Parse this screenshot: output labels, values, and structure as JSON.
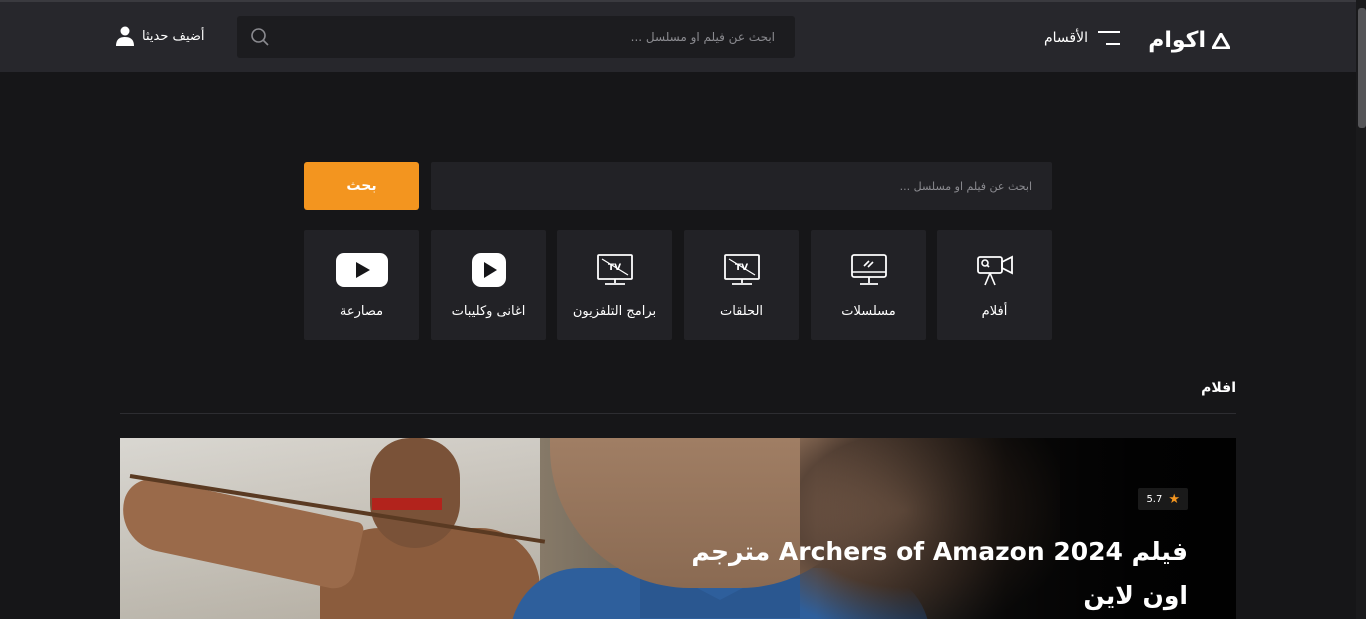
{
  "header": {
    "logo_text": "اكوام",
    "menu_label": "الأقسام",
    "search_placeholder": "ابحث عن فيلم او مسلسل ...",
    "recent_label": "أضيف حديثا"
  },
  "main_search": {
    "placeholder": "ابحث عن فيلم او مسلسل ...",
    "button_label": "بحث"
  },
  "categories": [
    {
      "label": "أفلام",
      "icon": "video-camera-icon"
    },
    {
      "label": "مسلسلات",
      "icon": "monitor-icon"
    },
    {
      "label": "الحلقات",
      "icon": "tv-icon"
    },
    {
      "label": "برامج التلفزيون",
      "icon": "tv-icon"
    },
    {
      "label": "اغانى وكليبات",
      "icon": "play-icon"
    },
    {
      "label": "مصارعة",
      "icon": "youtube-icon"
    }
  ],
  "section": {
    "title": "افلام"
  },
  "featured": {
    "rating": "5.7",
    "title": "فيلم Archers of Amazon 2024 مترجم اون لاين"
  },
  "colors": {
    "accent": "#f3951f",
    "header_bg": "#27272c",
    "page_bg": "#161618",
    "tile_bg": "#222226"
  }
}
